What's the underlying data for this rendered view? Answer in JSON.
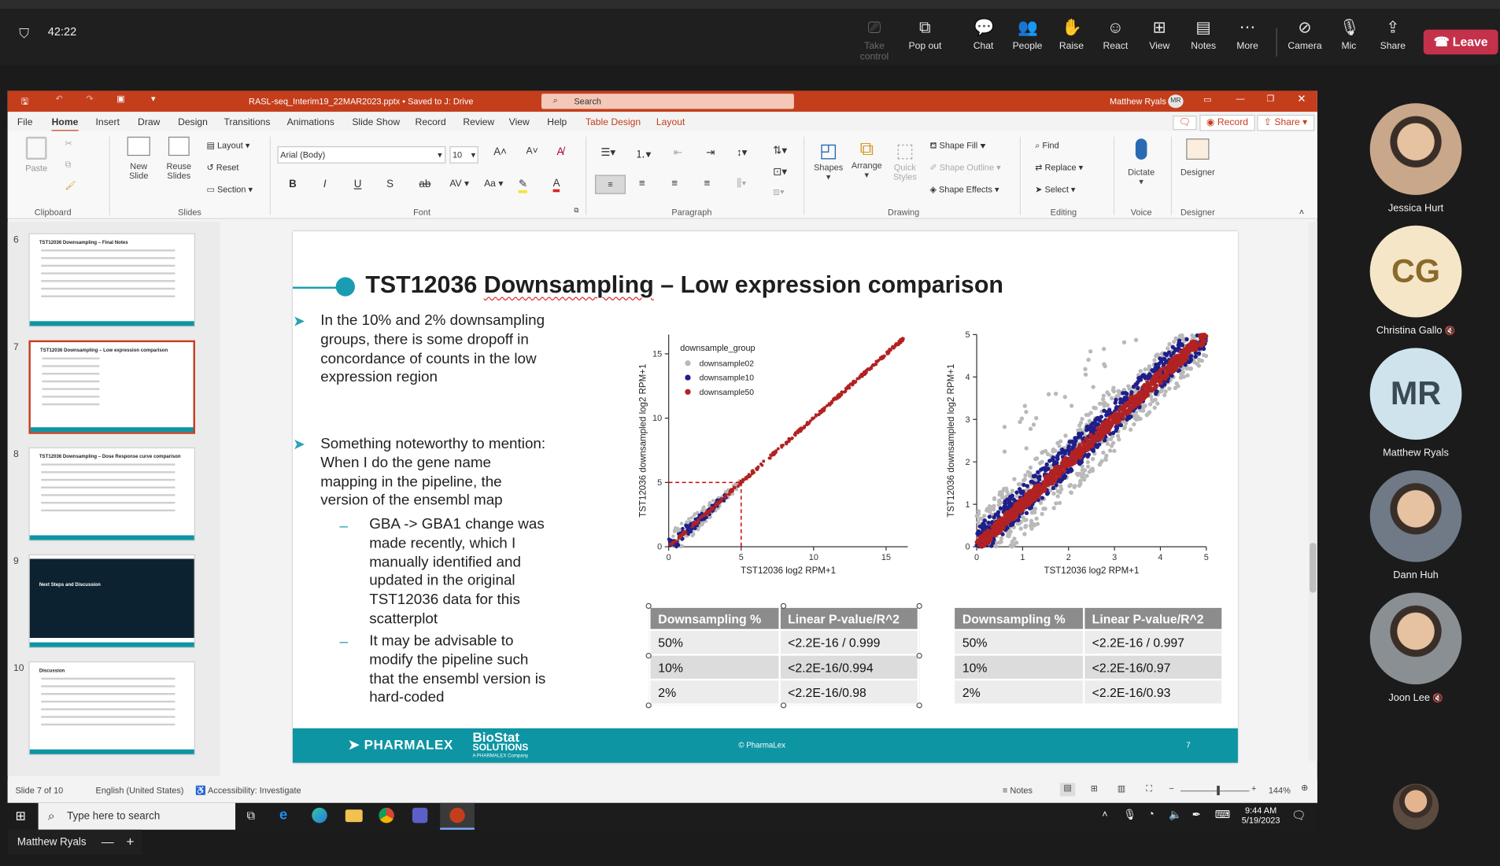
{
  "teams": {
    "timer": "42:22",
    "controls": [
      {
        "label": "Take control",
        "icon": "take-control-icon",
        "dim": true
      },
      {
        "label": "Pop out",
        "icon": "pop-out-icon"
      },
      {
        "label": "Chat",
        "icon": "chat-icon"
      },
      {
        "label": "People",
        "icon": "people-icon"
      },
      {
        "label": "Raise",
        "icon": "raise-hand-icon"
      },
      {
        "label": "React",
        "icon": "react-icon"
      },
      {
        "label": "View",
        "icon": "view-icon"
      },
      {
        "label": "Notes",
        "icon": "notes-icon"
      },
      {
        "label": "More",
        "icon": "more-icon"
      },
      {
        "label": "Camera",
        "icon": "camera-off-icon"
      },
      {
        "label": "Mic",
        "icon": "mic-icon"
      },
      {
        "label": "Share",
        "icon": "share-icon"
      }
    ],
    "leave_label": "Leave",
    "participants": [
      {
        "name": "Jessica Hurt",
        "initials": "",
        "muted": false,
        "bg": "#c9a78a"
      },
      {
        "name": "Christina Gallo",
        "initials": "CG",
        "muted": true,
        "bg": "#f5e6c8",
        "fg": "#8a6a2a"
      },
      {
        "name": "Matthew Ryals",
        "initials": "MR",
        "muted": false,
        "bg": "#cfe3ec",
        "fg": "#3a4a55"
      },
      {
        "name": "Dann Huh",
        "initials": "",
        "muted": false,
        "bg": "#6f7a86"
      },
      {
        "name": "Joon Lee",
        "initials": "",
        "muted": true,
        "bg": "#8a8f93"
      }
    ],
    "presenter_name": "Matthew Ryals",
    "minus": "—",
    "plus": "+"
  },
  "ppt": {
    "filename": "RASL-seq_Interim19_22MAR2023.pptx • Saved to J: Drive",
    "search_placeholder": "Search",
    "user": "Matthew Ryals",
    "user_initials": "MR",
    "tabs": [
      "File",
      "Home",
      "Insert",
      "Draw",
      "Design",
      "Transitions",
      "Animations",
      "Slide Show",
      "Record",
      "Review",
      "View",
      "Help",
      "Table Design",
      "Layout"
    ],
    "record_label": "Record",
    "share_label": "Share",
    "ribbon": {
      "paste": "Paste",
      "new_slide": "New Slide",
      "reuse_slides": "Reuse Slides",
      "layout": "Layout",
      "reset": "Reset",
      "section": "Section",
      "font_name": "Arial (Body)",
      "font_size": "10",
      "shapes": "Shapes",
      "arrange": "Arrange",
      "quick_styles": "Quick Styles",
      "shape_fill": "Shape Fill",
      "shape_outline": "Shape Outline",
      "shape_effects": "Shape Effects",
      "find": "Find",
      "replace": "Replace",
      "select": "Select",
      "dictate": "Dictate",
      "designer": "Designer",
      "groups": [
        "Clipboard",
        "Slides",
        "Font",
        "Paragraph",
        "Drawing",
        "Editing",
        "Voice",
        "Designer"
      ]
    },
    "thumbs": [
      {
        "num": "6",
        "title": "TST12036 Downsampling – Final Notes"
      },
      {
        "num": "7",
        "title": "TST12036 Downsampling – Low expression comparison"
      },
      {
        "num": "8",
        "title": "TST12036 Downsampling – Dose Response curve comparison"
      },
      {
        "num": "9",
        "title": "Next Steps and Discussion"
      },
      {
        "num": "10",
        "title": "Discussion"
      }
    ],
    "status": {
      "slide": "Slide 7 of 10",
      "language": "English (United States)",
      "accessibility": "Accessibility: Investigate",
      "notes": "Notes",
      "zoom": "144%"
    }
  },
  "slide": {
    "title_part1": "TST12036 ",
    "title_part2": "Downsampling",
    "title_part3": " – Low expression comparison",
    "bullet1": "In the 10% and 2% downsampling groups, there is some dropoff in concordance of counts in the low expression region",
    "bullet2": "Something noteworthy to mention: When I do the gene name mapping in the pipeline, the version of the ensembl map",
    "sub1": "GBA -> GBA1 change was made recently, which I manually identified and updated in the original TST12036 data for this scatterplot",
    "sub2": "It may be advisable to modify the pipeline such that the ensembl version is hard-coded",
    "footer_brand": "PHARMALEX",
    "footer_biostat1": "BioStat",
    "footer_biostat2": "SOLUTIONS",
    "footer_biostat3": "A PHARMALEX Company",
    "footer_copy": "© PharmaLex",
    "page_num": "7",
    "table_header": [
      "Downsampling %",
      "Linear P-value/R^2"
    ],
    "table_left": [
      [
        "50%",
        "<2.2E-16 / 0.999"
      ],
      [
        "10%",
        "<2.2E-16/0.994"
      ],
      [
        "2%",
        "<2.2E-16/0.98"
      ]
    ],
    "table_right": [
      [
        "50%",
        "<2.2E-16 / 0.997"
      ],
      [
        "10%",
        "<2.2E-16/0.97"
      ],
      [
        "2%",
        "<2.2E-16/0.93"
      ]
    ]
  },
  "chart_data": [
    {
      "type": "scatter",
      "xlabel": "TST12036 log2 RPM+1",
      "ylabel": "TST12036 downsampled log2 RPM+1",
      "xlim": [
        0,
        16.5
      ],
      "ylim": [
        0,
        16.5
      ],
      "xticks": [
        0,
        5,
        10,
        15
      ],
      "yticks": [
        0,
        5,
        10,
        15
      ],
      "legend_title": "downsample_group",
      "legend_position": "top-left",
      "series": [
        {
          "name": "downsample02",
          "color": "#b9b9b9"
        },
        {
          "name": "downsample10",
          "color": "#1f1f8a"
        },
        {
          "name": "downsample50",
          "color": "#b22222"
        }
      ],
      "reference_point": [
        5,
        5
      ]
    },
    {
      "type": "scatter",
      "xlabel": "TST12036 log2 RPM+1",
      "ylabel": "TST12036 downsampled log2 RPM+1",
      "xlim": [
        0,
        5
      ],
      "ylim": [
        0,
        5
      ],
      "xticks": [
        0,
        1,
        2,
        3,
        4,
        5
      ],
      "yticks": [
        0,
        1,
        2,
        3,
        4,
        5
      ]
    }
  ],
  "taskbar": {
    "search_placeholder": "Type here to search",
    "time": "9:44 AM",
    "date": "5/19/2023"
  }
}
